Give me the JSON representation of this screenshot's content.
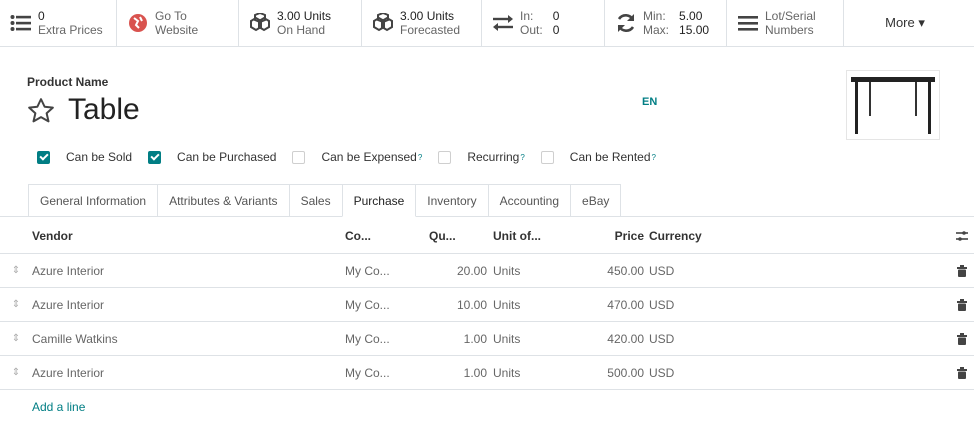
{
  "smart_buttons": [
    {
      "icon": "list-icon",
      "line1": "0",
      "line2": "Extra Prices"
    },
    {
      "icon": "globe-icon",
      "line1": "Go To",
      "line2": "Website"
    },
    {
      "icon": "cubes-icon",
      "line1": "3.00 Units",
      "line2": "On Hand"
    },
    {
      "icon": "cubes-icon",
      "line1": "3.00 Units",
      "line2": "Forecasted"
    },
    {
      "icon": "exchange-icon",
      "line1a": "In:",
      "line1b": "0",
      "line2a": "Out:",
      "line2b": "0"
    },
    {
      "icon": "refresh-icon",
      "line1a": "Min:",
      "line1b": "5.00",
      "line2a": "Max:",
      "line2b": "15.00"
    },
    {
      "icon": "bars-icon",
      "line1": "Lot/Serial",
      "line2": "Numbers"
    },
    {
      "label": "More ▾"
    }
  ],
  "header": {
    "product_name_label": "Product Name",
    "title": "Table",
    "lang": "EN"
  },
  "checkboxes": [
    {
      "label": "Can be Sold",
      "checked": true,
      "sup": ""
    },
    {
      "label": "Can be Purchased",
      "checked": true,
      "sup": ""
    },
    {
      "label": "Can be Expensed",
      "checked": false,
      "sup": "?"
    },
    {
      "label": "Recurring",
      "checked": false,
      "sup": "?"
    },
    {
      "label": "Can be Rented",
      "checked": false,
      "sup": "?"
    }
  ],
  "tabs": [
    "General Information",
    "Attributes & Variants",
    "Sales",
    "Purchase",
    "Inventory",
    "Accounting",
    "eBay"
  ],
  "active_tab": "Purchase",
  "table": {
    "columns": [
      "Vendor",
      "Co...",
      "Qu...",
      "Unit of...",
      "Price",
      "Currency"
    ],
    "rows": [
      {
        "vendor": "Azure Interior",
        "company": "My Co...",
        "qty": "20.00",
        "unit": "Units",
        "price": "450.00",
        "currency": "USD"
      },
      {
        "vendor": "Azure Interior",
        "company": "My Co...",
        "qty": "10.00",
        "unit": "Units",
        "price": "470.00",
        "currency": "USD"
      },
      {
        "vendor": "Camille Watkins",
        "company": "My Co...",
        "qty": "1.00",
        "unit": "Units",
        "price": "420.00",
        "currency": "USD"
      },
      {
        "vendor": "Azure Interior",
        "company": "My Co...",
        "qty": "1.00",
        "unit": "Units",
        "price": "500.00",
        "currency": "USD"
      }
    ],
    "add_line": "Add a line"
  },
  "colors": {
    "accent": "#017e84",
    "brand_red": "#d9534f"
  }
}
